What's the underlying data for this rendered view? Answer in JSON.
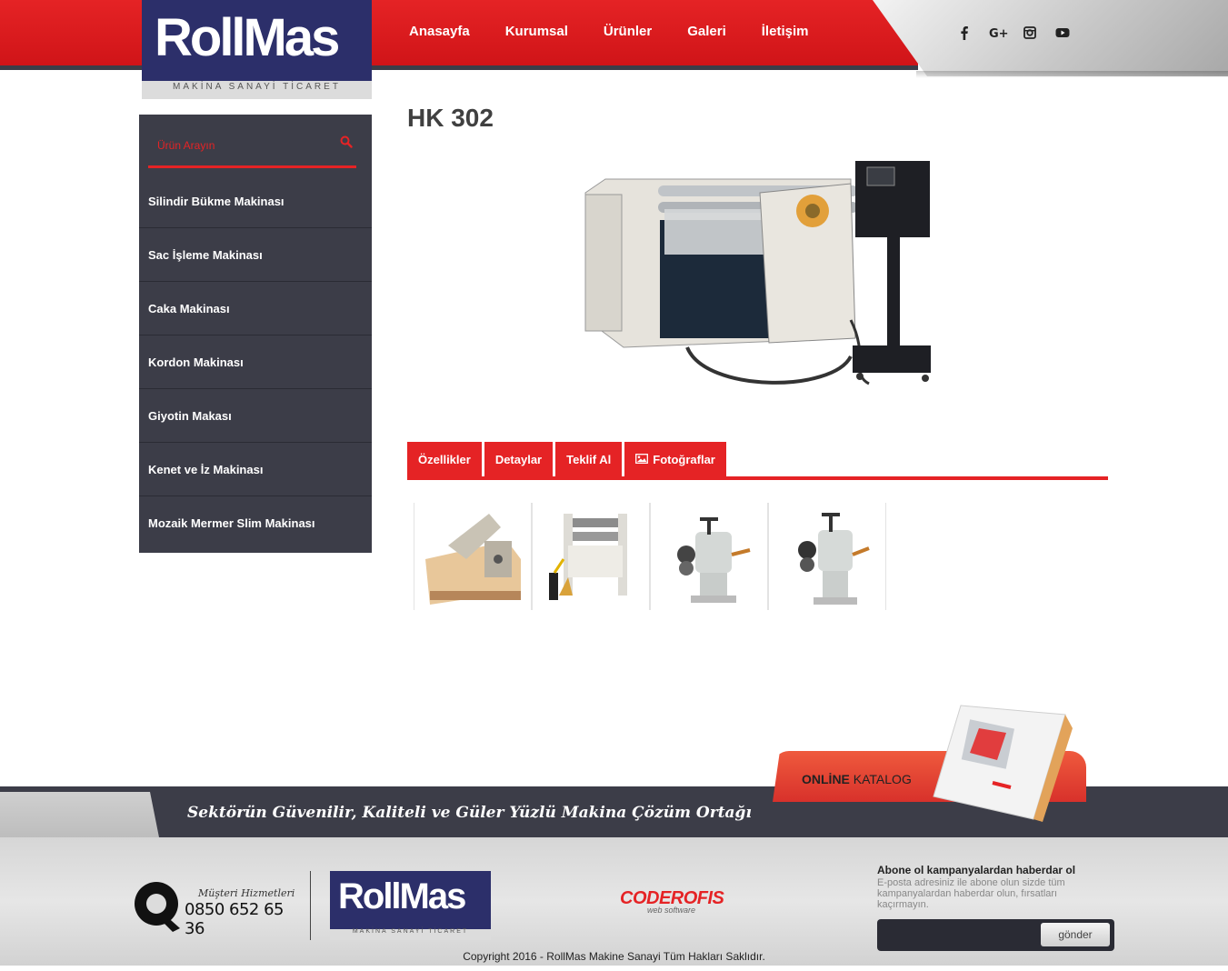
{
  "brand": {
    "logo_roll": "Roll",
    "logo_mas": "Mas",
    "logo_subtitle": "MAKİNA SANAYİ TİCARET"
  },
  "nav": {
    "items": [
      {
        "label": "Anasayfa"
      },
      {
        "label": "Kurumsal"
      },
      {
        "label": "Ürünler"
      },
      {
        "label": "Galeri"
      },
      {
        "label": "İletişim"
      }
    ]
  },
  "social": {
    "icons": [
      "facebook-icon",
      "google-plus-icon",
      "instagram-icon",
      "youtube-icon"
    ],
    "facebook": "f",
    "google": "G+"
  },
  "sidebar": {
    "search_placeholder": "Ürün Arayın",
    "items": [
      {
        "label": "Silindir Bükme Makinası"
      },
      {
        "label": "Sac İşleme Makinası"
      },
      {
        "label": "Caka Makinası"
      },
      {
        "label": "Kordon Makinası"
      },
      {
        "label": "Giyotin Makası"
      },
      {
        "label": "Kenet ve İz Makinası"
      },
      {
        "label": "Mozaik Mermer Slim Makinası"
      }
    ]
  },
  "product": {
    "title": "HK 302"
  },
  "tabs": {
    "items": [
      {
        "label": "Özellikler"
      },
      {
        "label": "Detaylar"
      },
      {
        "label": "Teklif Al"
      },
      {
        "label": "Fotoğraflar"
      }
    ]
  },
  "footer": {
    "slogan": "Sektörün Güvenilir, Kaliteli ve Güler Yüzlü Makina Çözüm Ortağı",
    "catalog_online": "ONLİNE",
    "catalog_word": "KATALOG",
    "hotline_label": "Müşteri Hizmetleri",
    "hotline_number": "0850 652 65 36",
    "developer": "CODEROFIS",
    "developer_sub": "web software",
    "newsletter_title": "Abone ol kampanyalardan haberdar ol",
    "newsletter_desc": "E-posta adresiniz ile abone olun sizde tüm kampanyalardan haberdar olun, fırsatları kaçırmayın.",
    "newsletter_button": "gönder",
    "copyright": "Copyright 2016 - RollMas Makine Sanayi Tüm Hakları Saklıdır."
  },
  "colors": {
    "brand_red": "#e52325",
    "dark": "#3c3d48",
    "navy": "#2c2f6a"
  }
}
